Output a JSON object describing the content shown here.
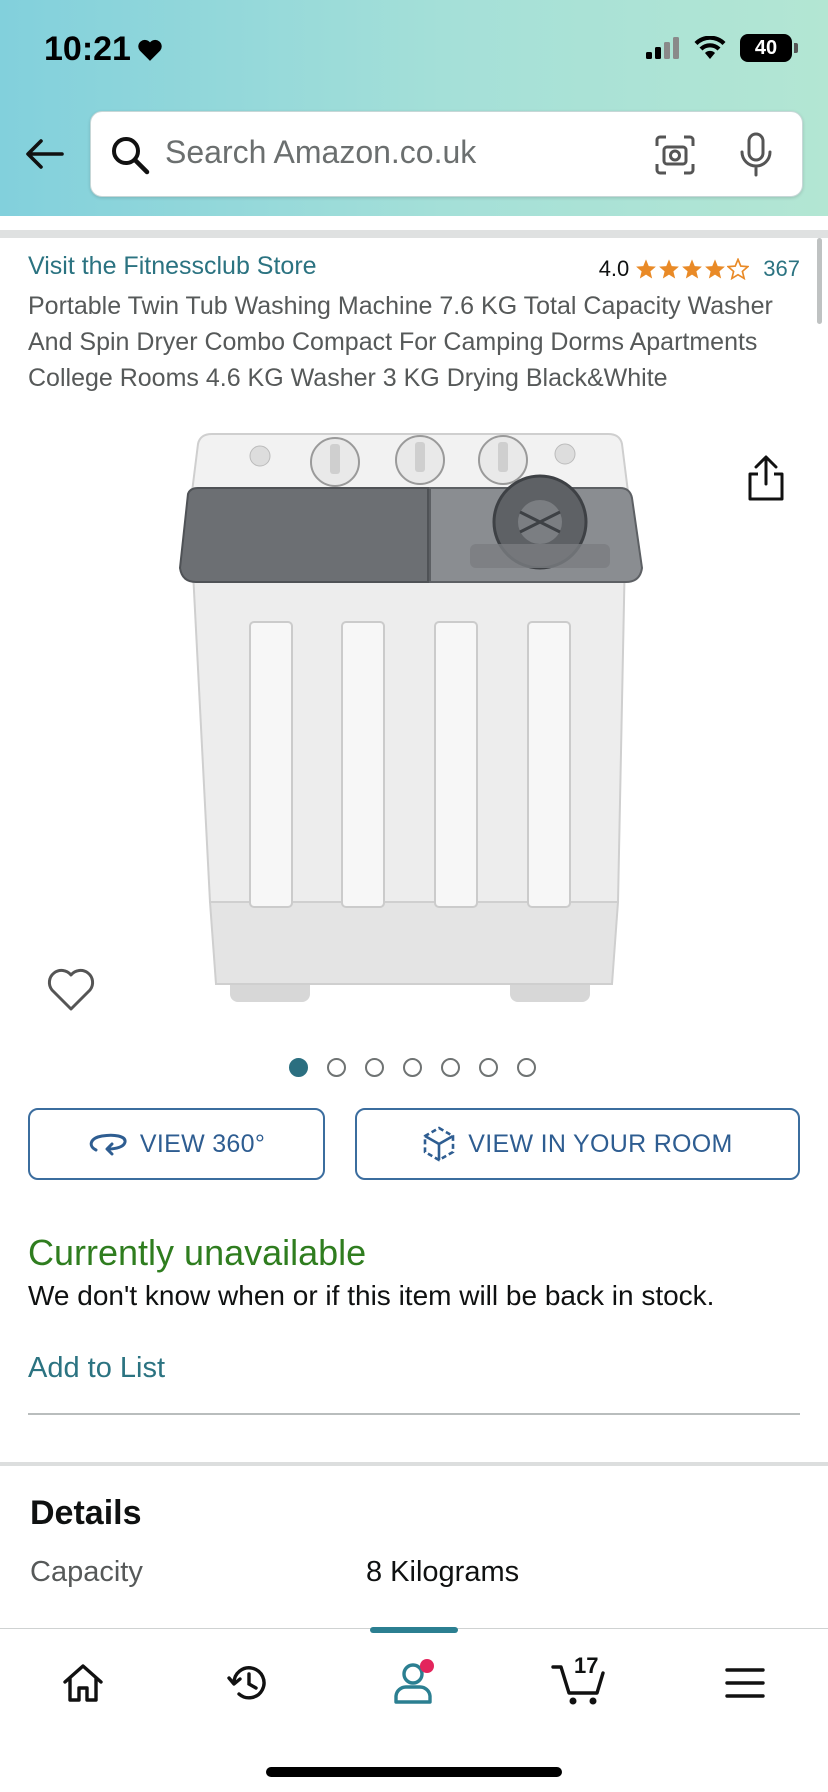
{
  "status_bar": {
    "time": "10:21",
    "battery": "40"
  },
  "search": {
    "placeholder": "Search Amazon.co.uk"
  },
  "product": {
    "store_link": "Visit the Fitnessclub Store",
    "rating": "4.0",
    "rating_stars": 4.0,
    "review_count": "367",
    "title": "Portable Twin Tub Washing Machine 7.6 KG Total Capacity Washer And Spin Dryer Combo Compact For Camping Dorms Apartments College Rooms 4.6 KG Washer 3 KG Drying Black&White",
    "image_count": 7,
    "active_image": 1
  },
  "buttons": {
    "view_360": "VIEW 360°",
    "view_room": "VIEW IN YOUR ROOM"
  },
  "availability": {
    "status": "Currently unavailable",
    "message": "We don't know when or if this item will be back in stock.",
    "add_to_list": "Add to List"
  },
  "details": {
    "heading": "Details",
    "rows": [
      {
        "key": "Capacity",
        "value": "8 Kilograms"
      }
    ]
  },
  "tabbar": {
    "cart_count": "17"
  },
  "colors": {
    "link": "#2b7381",
    "unavailable": "#2f7d1f",
    "star": "#e98a27",
    "accent": "#2b7f91",
    "badge": "#e3255c"
  },
  "icons": [
    "back-arrow-icon",
    "search-icon",
    "camera-icon",
    "mic-icon",
    "share-icon",
    "heart-icon",
    "rotate-360-icon",
    "cube-ar-icon",
    "home-icon",
    "history-icon",
    "account-icon",
    "cart-icon",
    "menu-icon"
  ]
}
